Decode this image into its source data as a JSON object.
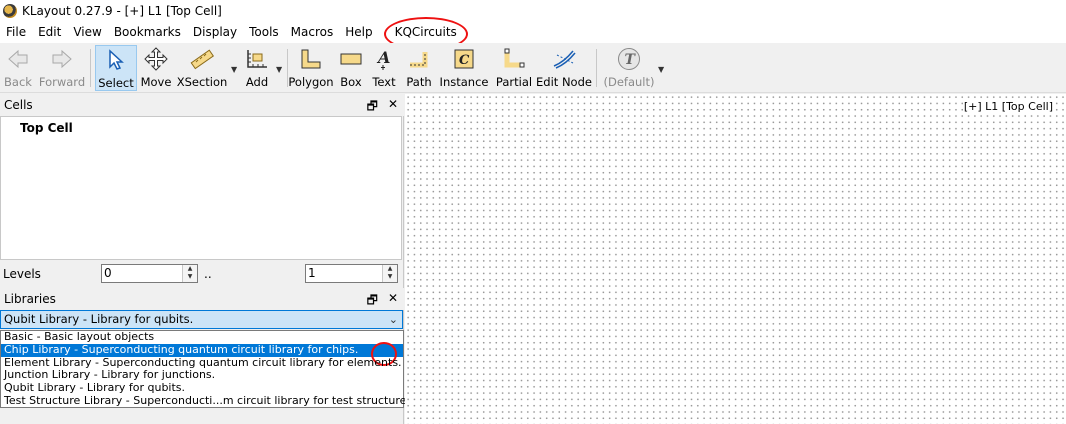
{
  "window": {
    "title": "KLayout 0.27.9 - [+] L1 [Top Cell]"
  },
  "menu": [
    "File",
    "Edit",
    "View",
    "Bookmarks",
    "Display",
    "Tools",
    "Macros",
    "Help",
    "KQCircuits"
  ],
  "toolbar": {
    "back": "Back",
    "forward": "Forward",
    "select": "Select",
    "move": "Move",
    "xsection": "XSection",
    "add": "Add",
    "polygon": "Polygon",
    "box": "Box",
    "text": "Text",
    "path": "Path",
    "instance": "Instance",
    "partial": "Partial",
    "edit_node": "Edit Node",
    "default": "(Default)"
  },
  "cells_panel": {
    "title": "Cells",
    "tree_root": "Top Cell"
  },
  "levels": {
    "label": "Levels",
    "from": "0",
    "separator": "..",
    "to": "1"
  },
  "libraries_panel": {
    "title": "Libraries",
    "selected": "Qubit Library - Library for qubits.",
    "options": [
      "Basic - Basic layout objects",
      "Chip Library - Superconducting quantum circuit library for chips.",
      "Element Library - Superconducting quantum circuit library for elements.",
      "Junction Library - Library for junctions.",
      "Qubit Library - Library for qubits.",
      "Test Structure Library - Superconducti...m circuit library for test structures."
    ],
    "highlighted_index": 1
  },
  "canvas": {
    "title": "[+] L1 [Top Cell]"
  },
  "colors": {
    "selection": "#0078d7",
    "annotation": "#ee1111",
    "selected_button": "#cce4f7"
  }
}
